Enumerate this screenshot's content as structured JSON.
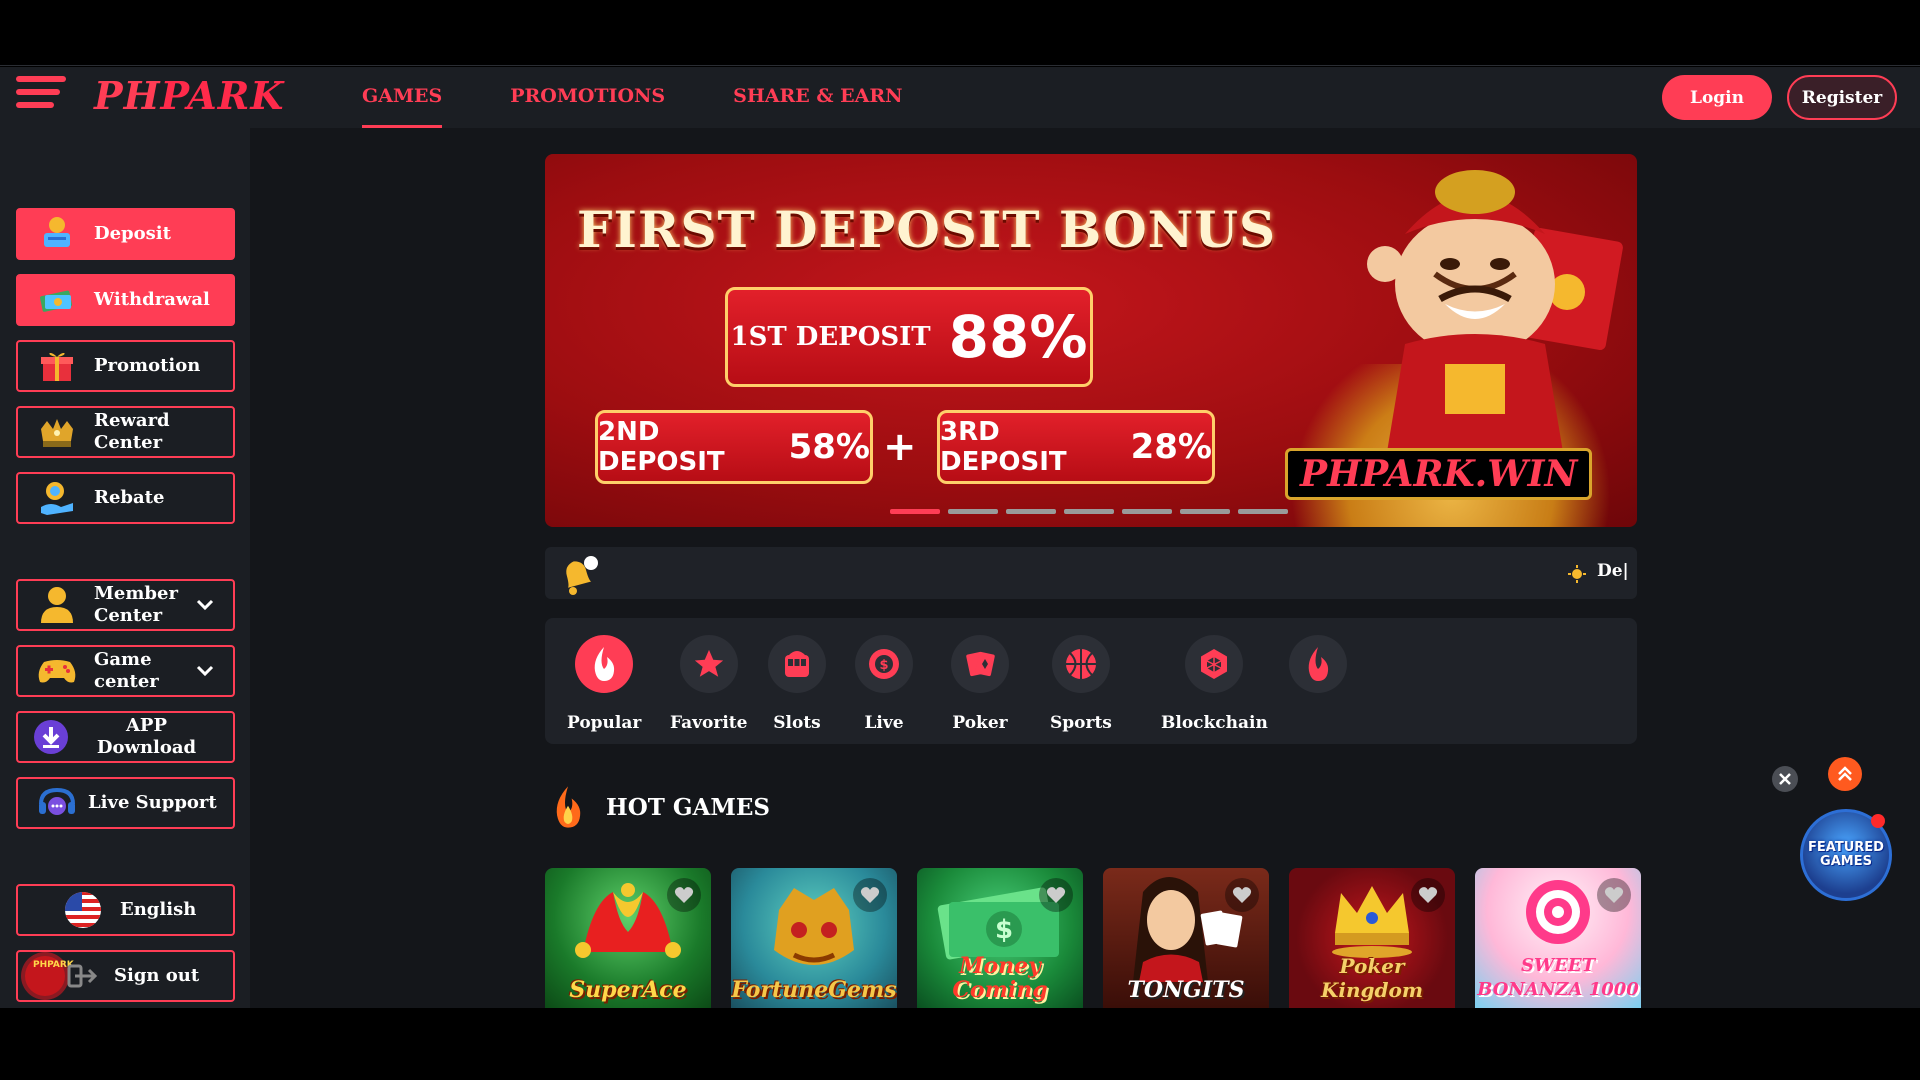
{
  "header": {
    "logo_ph": "PH",
    "logo_park": "PARK",
    "nav": [
      {
        "label": "GAMES",
        "active": true
      },
      {
        "label": "PROMOTIONS",
        "active": false
      },
      {
        "label": "SHARE & EARN",
        "active": false
      }
    ],
    "login_label": "Login",
    "register_label": "Register"
  },
  "sidebar": {
    "items": [
      {
        "label": "Deposit",
        "icon": "deposit-icon"
      },
      {
        "label": "Withdrawal",
        "icon": "withdrawal-icon"
      },
      {
        "label": "Promotion",
        "icon": "gift-icon"
      },
      {
        "label": "Reward Center",
        "icon": "reward-icon"
      },
      {
        "label": "Rebate",
        "icon": "rebate-icon"
      },
      {
        "label": "Member Center",
        "icon": "member-icon"
      },
      {
        "label": "Game center",
        "icon": "gamepad-icon"
      },
      {
        "label": "APP Download",
        "icon": "download-icon"
      },
      {
        "label": "Live Support",
        "icon": "support-icon"
      },
      {
        "label": "English",
        "icon": "us-flag-icon"
      },
      {
        "label": "Sign out",
        "icon": "sign-out-icon"
      }
    ]
  },
  "banner": {
    "title": "FIRST DEPOSIT BONUS",
    "first_label": "1ST DEPOSIT",
    "first_pct": "88%",
    "second_label": "2ND DEPOSIT",
    "second_pct": "58%",
    "third_label": "3RD DEPOSIT",
    "third_pct": "28%",
    "plus": "+",
    "site_a": "PHPARK.",
    "site_b": "WIN",
    "slide_count": 7,
    "active_slide": 1
  },
  "marquee": {
    "text": "De|"
  },
  "categories": [
    {
      "label": "Popular",
      "icon": "fire-icon",
      "active": true
    },
    {
      "label": "Favorite",
      "icon": "star-icon",
      "active": false
    },
    {
      "label": "Slots",
      "icon": "slot-machine-icon",
      "active": false
    },
    {
      "label": "Live",
      "icon": "chip-icon",
      "active": false
    },
    {
      "label": "Poker",
      "icon": "cards-icon",
      "active": false
    },
    {
      "label": "Sports",
      "icon": "basketball-icon",
      "active": false
    },
    {
      "label": "Blockchain",
      "icon": "blockchain-icon",
      "active": false
    }
  ],
  "hot_games": {
    "title": "HOT GAMES",
    "games": [
      {
        "name": "SuperAce"
      },
      {
        "name": "FortuneGems"
      },
      {
        "name": "Money Coming"
      },
      {
        "name": "TONGITS"
      },
      {
        "name": "Poker Kingdom"
      },
      {
        "name": "SWEET BONANZA 1000"
      }
    ]
  },
  "floating": {
    "featured_line1": "FEATURED",
    "featured_line2": "GAMES"
  },
  "colors": {
    "accent": "#ff3d55",
    "page_bg": "#14161a",
    "panel_bg": "#1b1e23"
  }
}
